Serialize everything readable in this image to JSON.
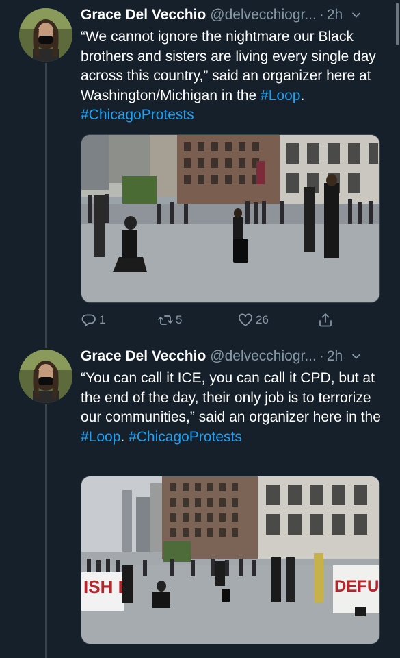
{
  "tweets": [
    {
      "name": "Grace Del Vecchio",
      "handle": "@delvecchiogr...",
      "time": "2h",
      "text_parts": [
        "“We cannot ignore the nightmare our Black brothers and sisters are living every single day across this country,” said an organizer here at Washington/Michigan in the ",
        "#Loop",
        ". ",
        "#ChicagoProtests"
      ],
      "replies": "1",
      "retweets": "5",
      "likes": "26"
    },
    {
      "name": "Grace Del Vecchio",
      "handle": "@delvecchiogr...",
      "time": "2h",
      "text_parts": [
        "“You can call it ICE, you can call it CPD, but at the end of the day, their only job is to terrorize our communities,” said an organizer here in the ",
        "#Loop",
        ". ",
        "#ChicagoProtests"
      ],
      "sign_left": "ISH E",
      "sign_right": "DEFUN"
    }
  ],
  "colors": {
    "background": "#15202b",
    "muted": "#8899a6",
    "link": "#1da1f2",
    "divider": "#38444d"
  },
  "icons": [
    "reply-icon",
    "retweet-icon",
    "like-icon",
    "share-icon",
    "chevron-down-icon"
  ]
}
